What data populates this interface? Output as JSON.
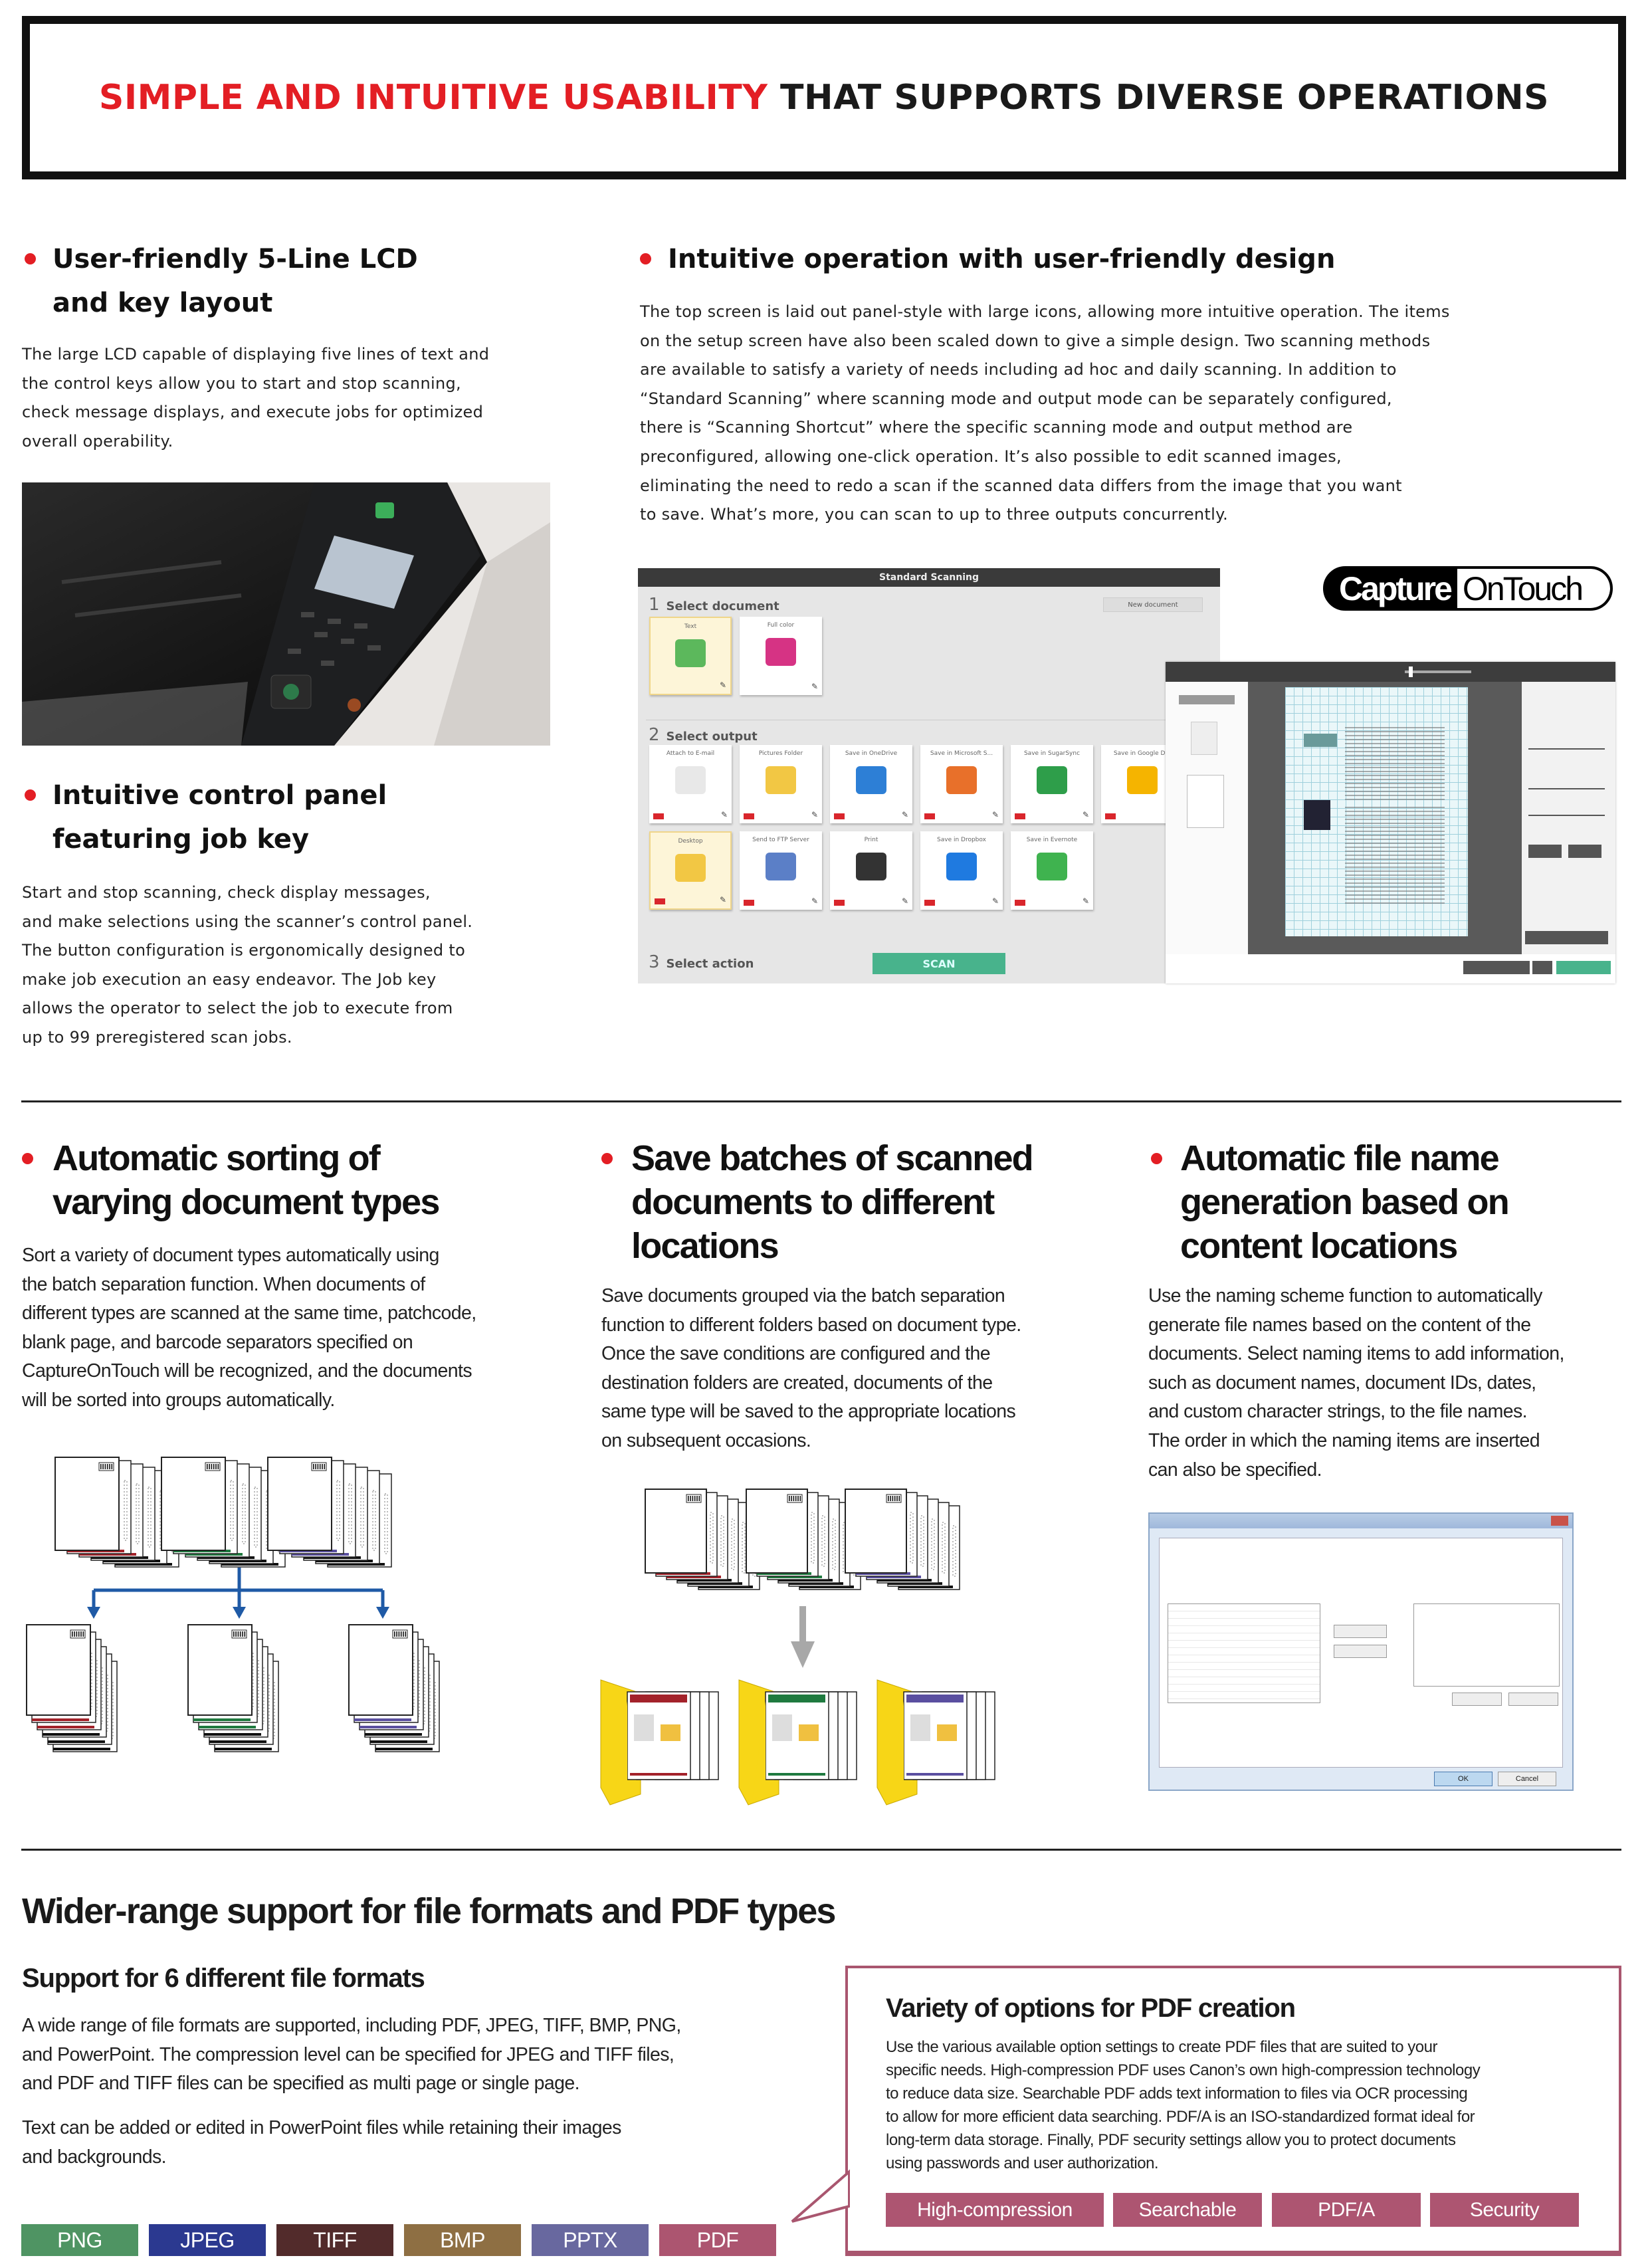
{
  "title": {
    "highlight": "SIMPLE AND INTUITIVE USABILITY",
    "rest": " THAT SUPPORTS DIVERSE OPERATIONS",
    "accent_color": "#e31e24"
  },
  "lcd": {
    "heading": [
      "User-friendly 5-Line LCD",
      "and key layout"
    ],
    "body": [
      "The large LCD capable of displaying five lines of text and",
      "the control keys allow you to start and stop scanning,",
      "check message displays, and execute jobs for optimized",
      "overall operability."
    ]
  },
  "panel": {
    "heading": [
      "Intuitive control panel",
      "featuring job key"
    ],
    "body": [
      "Start and stop scanning, check display messages,",
      "and make selections using the scanner’s control panel.",
      "The button configuration is ergonomically designed to",
      "make job execution an easy endeavor. The Job key",
      "allows the operator to select the job to execute from",
      "up to 99 preregistered scan jobs."
    ]
  },
  "intuitive": {
    "heading": "Intuitive operation with user-friendly design",
    "body": [
      "The top screen is laid out panel-style with large icons, allowing more intuitive operation. The items",
      "on the setup screen have also been scaled down to give a simple design. Two scanning methods",
      "are available to satisfy a variety of needs including ad hoc and daily scanning. In addition to",
      "“Standard Scanning” where scanning mode and output mode can be separately configured,",
      "there is “Scanning Shortcut” where the specific scanning mode and output method are",
      "preconfigured, allowing one-click operation. It’s also possible to edit scanned images,",
      "eliminating the need to redo a scan if the scanned data differs from the image that you want",
      "to save. What’s more, you can scan to up to three outputs concurrently."
    ]
  },
  "app": {
    "window_title": "Standard Scanning",
    "step1": {
      "num": "1",
      "label": "Select document",
      "dropdown": "New document"
    },
    "step2": {
      "num": "2",
      "label": "Select output"
    },
    "step3": {
      "num": "3",
      "label": "Select action"
    },
    "scan_button": "SCAN",
    "documents": [
      {
        "label": "Text",
        "color": "#5cb85c"
      },
      {
        "label": "Full color",
        "color": "#d63384"
      }
    ],
    "outputs": [
      {
        "label": "Attach to E-mail",
        "color": "#e8e8e8"
      },
      {
        "label": "Pictures Folder",
        "color": "#f2c744"
      },
      {
        "label": "Save in OneDrive",
        "color": "#2d7fd6"
      },
      {
        "label": "Save in Microsoft S...",
        "color": "#e8702a"
      },
      {
        "label": "Save in SugarSync",
        "color": "#2e9e4a"
      },
      {
        "label": "Save in Google D...",
        "color": "#f5b400"
      },
      {
        "label": "Desktop",
        "color": "#f2c744"
      },
      {
        "label": "Send to FTP Server",
        "color": "#5b7fc7"
      },
      {
        "label": "Print",
        "color": "#333333"
      },
      {
        "label": "Save in Dropbox",
        "color": "#1f7ae0"
      },
      {
        "label": "Save in Evernote",
        "color": "#3fb34f"
      }
    ],
    "logo": {
      "part1": "Capture",
      "part2": "OnTouch"
    }
  },
  "sorting": {
    "heading": [
      "Automatic sorting of",
      "varying document types"
    ],
    "body": [
      "Sort a variety of document types automatically using",
      "the batch separation function. When documents of",
      "different types are scanned at the same time, patchcode,",
      "blank page, and barcode separators specified on",
      "CaptureOnTouch will be recognized, and the documents",
      "will be sorted into groups automatically."
    ]
  },
  "batches": {
    "heading": [
      "Save batches of scanned",
      "documents to different",
      "locations"
    ],
    "body": [
      "Save documents grouped via the batch separation",
      "function to different folders based on document type.",
      "Once the save conditions are configured and the",
      "destination folders are created, documents of the",
      "same type will be saved to the appropriate locations",
      "on subsequent occasions."
    ]
  },
  "naming": {
    "heading": [
      "Automatic file name",
      "generation based on",
      "content locations"
    ],
    "body": [
      "Use the naming scheme function to automatically",
      "generate file names based on the content of the",
      "documents. Select naming items to add information,",
      "such as document names, document IDs, dates,",
      "and custom character strings, to the file names.",
      "The order in which the naming items are inserted",
      "can also be specified."
    ],
    "dialog": {
      "ok": "OK",
      "cancel": "Cancel"
    }
  },
  "formats": {
    "heading": "Wider-range support for file formats and PDF types",
    "subheading": "Support for 6 different file formats",
    "body1": [
      "A wide range of file formats are supported, including PDF, JPEG, TIFF, BMP, PNG,",
      "and PowerPoint. The compression level can be specified for JPEG and TIFF files,",
      "and PDF and TIFF files can be specified as multi page or single page."
    ],
    "body2": [
      "Text can be added or edited in PowerPoint files while retaining their images",
      "and backgrounds."
    ],
    "badges": [
      {
        "label": "PNG",
        "color": "#4f9463"
      },
      {
        "label": "JPEG",
        "color": "#2b3990"
      },
      {
        "label": "TIFF",
        "color": "#522b2b"
      },
      {
        "label": "BMP",
        "color": "#8e6f43"
      },
      {
        "label": "PPTX",
        "color": "#68689f"
      },
      {
        "label": "PDF",
        "color": "#ac5570"
      }
    ]
  },
  "pdf_options": {
    "heading": "Variety of options for PDF creation",
    "body": [
      "Use the various available option settings to create PDF files that are suited to your",
      "specific needs. High-compression PDF uses Canon’s own high-compression technology",
      "to reduce data size. Searchable PDF adds text information to files via OCR processing",
      "to allow for more efficient data searching. PDF/A is an ISO-standardized format ideal for",
      "long-term data storage. Finally, PDF security settings allow you to protect documents",
      "using passwords and user authorization."
    ],
    "options": [
      "High-compression",
      "Searchable",
      "PDF/A",
      "Security"
    ],
    "color": "#ad5571"
  }
}
